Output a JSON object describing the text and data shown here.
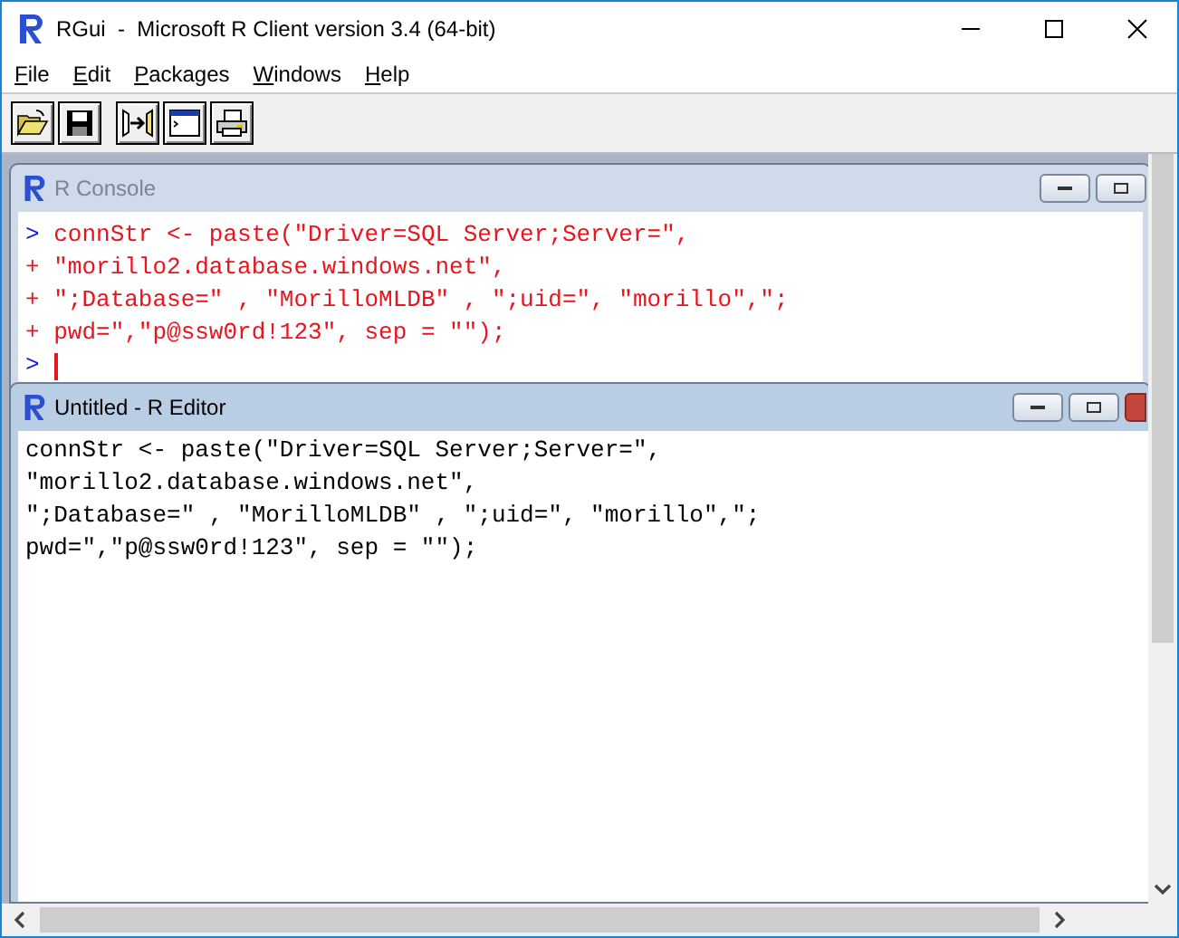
{
  "window": {
    "title": "RGui  -  Microsoft R Client version 3.4 (64-bit)"
  },
  "menu": [
    {
      "label": "File"
    },
    {
      "label": "Edit"
    },
    {
      "label": "Packages"
    },
    {
      "label": "Windows"
    },
    {
      "label": "Help"
    }
  ],
  "console": {
    "title": "R Console",
    "active": false,
    "lines": [
      {
        "kind": "command",
        "prompt": ">",
        "text": "connStr <- paste(\"Driver=SQL Server;Server=\","
      },
      {
        "kind": "continuation",
        "prompt": "+",
        "text": "\"morillo2.database.windows.net\","
      },
      {
        "kind": "continuation",
        "prompt": "+",
        "text": "\";Database=\" , \"MorilloMLDB\" , \";uid=\", \"morillo\",\";"
      },
      {
        "kind": "continuation",
        "prompt": "+",
        "text": "pwd=\",\"p@ssw0rd!123\", sep = \"\");"
      },
      {
        "kind": "command",
        "prompt": ">"
      }
    ],
    "cursor": true
  },
  "editor": {
    "title": "Untitled - R Editor",
    "active": true,
    "lines": [
      "connStr <- paste(\"Driver=SQL Server;Server=\",",
      "\"morillo2.database.windows.net\",",
      "\";Database=\" , \"MorilloMLDB\" , \";uid=\", \"morillo\",\";",
      "pwd=\",\"p@ssw0rd!123\", sep = \"\");"
    ]
  }
}
